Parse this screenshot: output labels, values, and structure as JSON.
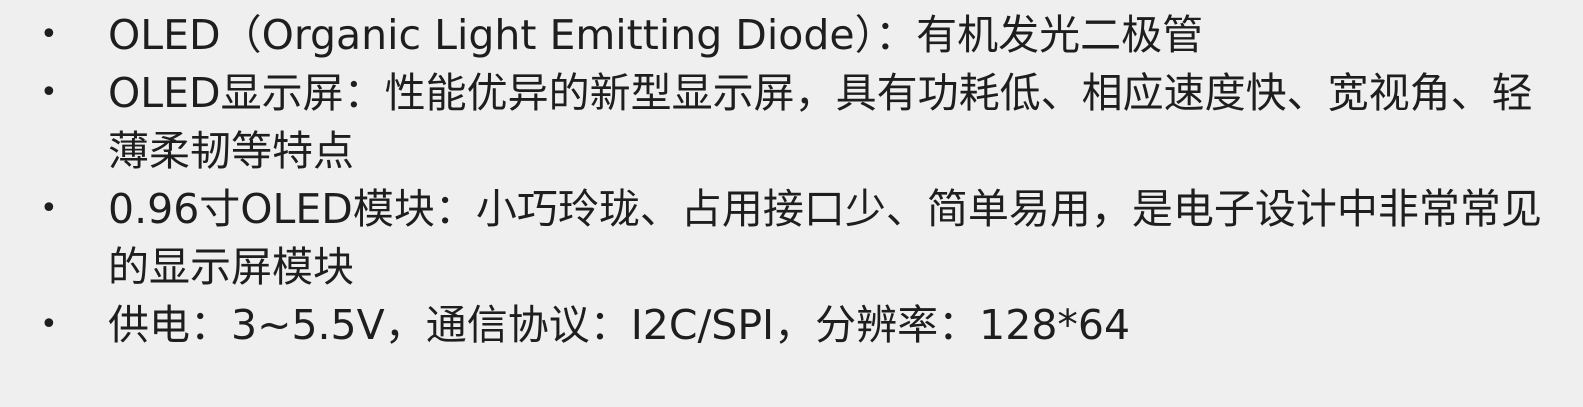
{
  "bullet_symbol": "•",
  "items": [
    {
      "text": "OLED（Organic Light Emitting Diode）：有机发光二极管"
    },
    {
      "text": "OLED显示屏：性能优异的新型显示屏，具有功耗低、相应速度快、宽视角、轻薄柔韧等特点"
    },
    {
      "text": "0.96寸OLED模块：小巧玲珑、占用接口少、简单易用，是电子设计中非常常见的显示屏模块"
    },
    {
      "text": "供电：3~5.5V，通信协议：I2C/SPI，分辨率：128*64"
    }
  ]
}
